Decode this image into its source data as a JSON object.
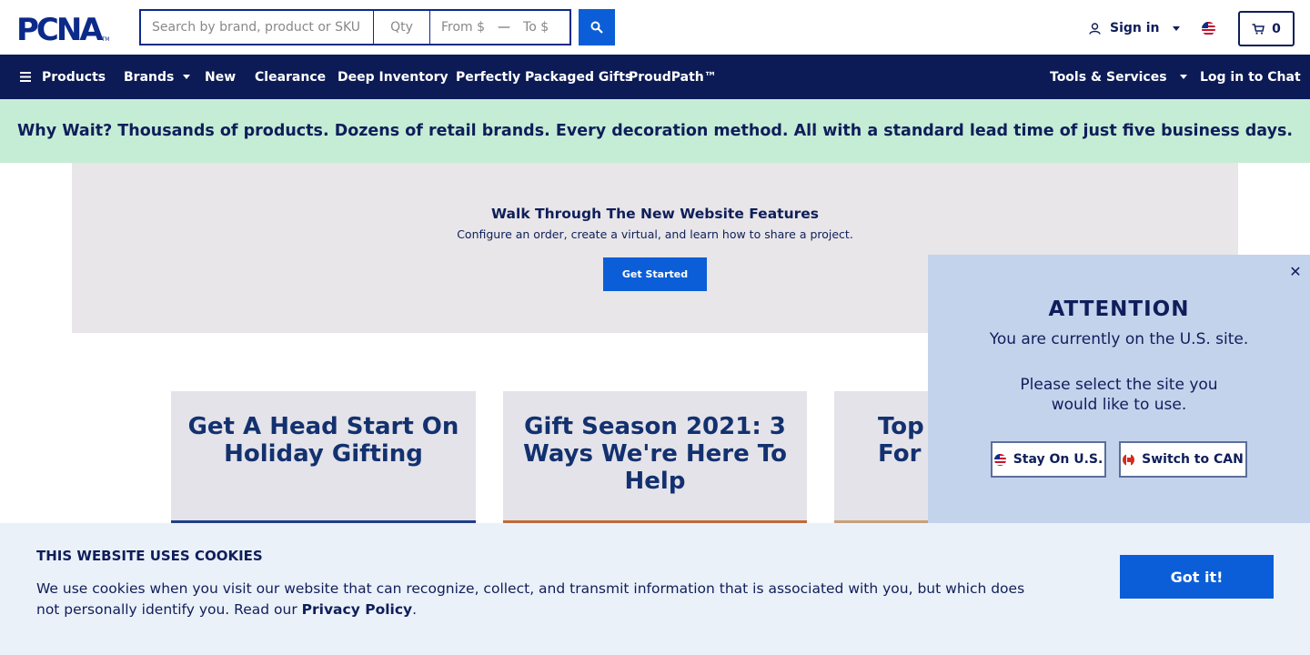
{
  "header": {
    "logo": "PCNA",
    "logo_tm": "TM",
    "search_placeholder": "Search by brand, product or SKU",
    "qty_placeholder": "Qty",
    "from_placeholder": "From $",
    "to_placeholder": "To $",
    "sign_in": "Sign in",
    "cart_count": "0"
  },
  "nav": {
    "products": "Products",
    "brands": "Brands",
    "new": "New",
    "clearance": "Clearance",
    "deep_inventory": "Deep Inventory",
    "gifts": "Perfectly Packaged Gifts",
    "proudpath": "ProudPath™",
    "tools": "Tools & Services",
    "chat": "Log in to Chat"
  },
  "promo": {
    "text": "Why Wait? Thousands of products. Dozens of retail brands. Every decoration method. All with a standard lead time of just five business days."
  },
  "feature": {
    "title": "Walk Through The New Website Features",
    "subtitle": "Configure an order, create a virtual, and learn how to share a project.",
    "button": "Get Started"
  },
  "cards": [
    {
      "title": "Get A Head Start On Holiday Gifting",
      "strip_color": "#1f3f88"
    },
    {
      "title": "Gift Season 2021: 3 Ways We're Here To Help",
      "strip_color": "#c16a3a"
    },
    {
      "title": "Top For",
      "strip_color": "#c9a07a"
    }
  ],
  "attention": {
    "close": "✕",
    "title": "ATTENTION",
    "line1": "You are currently on the U.S. site.",
    "line2": "Please select the site you would like to use.",
    "stay_us": "Stay On U.S.",
    "switch_can": "Switch to CAN"
  },
  "cookie": {
    "title": "THIS WEBSITE USES COOKIES",
    "text": "We use cookies when you visit our website that can recognize, collect, and transmit information that is associated with you, but which does not personally identify you. Read our ",
    "link": "Privacy Policy",
    "period": ".",
    "button": "Got it!"
  },
  "colors": {
    "navy": "#0c1b55",
    "accent_blue": "#0b5ed7",
    "promo_green": "#c5edd5",
    "popup_blue": "#c4d3ec"
  }
}
